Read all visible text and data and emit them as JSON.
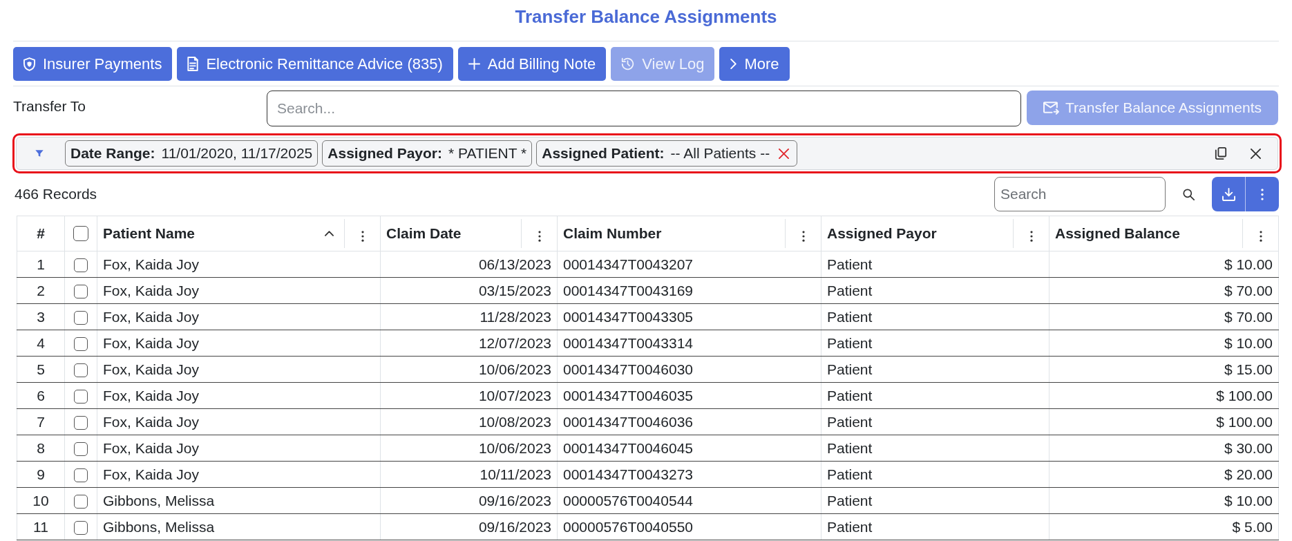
{
  "title": "Transfer Balance Assignments",
  "toolbar": [
    {
      "label": "Insurer Payments",
      "disabled": false
    },
    {
      "label": "Electronic Remittance Advice (835)",
      "disabled": false
    },
    {
      "label": "Add Billing Note",
      "disabled": false
    },
    {
      "label": "View Log",
      "disabled": true
    },
    {
      "label": "More",
      "disabled": false
    }
  ],
  "transfer": {
    "label": "Transfer To",
    "placeholder": "Search...",
    "button": {
      "label": "Transfer Balance Assignments",
      "disabled": true
    }
  },
  "filter_bar": {
    "highlighted": true,
    "filters": [
      {
        "label": "Date Range:",
        "value": "11/01/2020, 11/17/2025",
        "removable": false
      },
      {
        "label": "Assigned Payor:",
        "value": "* PATIENT *",
        "removable": false
      },
      {
        "label": "Assigned Patient:",
        "value": "-- All Patients --",
        "removable": true
      }
    ]
  },
  "record_count": "466 Records",
  "search": {
    "placeholder": "Search"
  },
  "table": {
    "columns": [
      {
        "kind": "index",
        "label": "#"
      },
      {
        "kind": "select",
        "checked": false
      },
      {
        "kind": "text",
        "label": "Patient Name",
        "sorted": true
      },
      {
        "kind": "date",
        "label": "Claim Date"
      },
      {
        "kind": "text",
        "label": "Claim Number"
      },
      {
        "kind": "text",
        "label": "Assigned Payor"
      },
      {
        "kind": "money",
        "label": "Assigned Balance"
      }
    ],
    "rows": [
      {
        "checked": false,
        "cells": [
          "1",
          "",
          "Fox, Kaida Joy",
          "06/13/2023",
          "00014347T0043207",
          "Patient",
          "$ 10.00"
        ]
      },
      {
        "checked": false,
        "cells": [
          "2",
          "",
          "Fox, Kaida Joy",
          "03/15/2023",
          "00014347T0043169",
          "Patient",
          "$ 70.00"
        ]
      },
      {
        "checked": false,
        "cells": [
          "3",
          "",
          "Fox, Kaida Joy",
          "11/28/2023",
          "00014347T0043305",
          "Patient",
          "$ 70.00"
        ]
      },
      {
        "checked": false,
        "cells": [
          "4",
          "",
          "Fox, Kaida Joy",
          "12/07/2023",
          "00014347T0043314",
          "Patient",
          "$ 10.00"
        ]
      },
      {
        "checked": false,
        "cells": [
          "5",
          "",
          "Fox, Kaida Joy",
          "10/06/2023",
          "00014347T0046030",
          "Patient",
          "$ 15.00"
        ]
      },
      {
        "checked": false,
        "cells": [
          "6",
          "",
          "Fox, Kaida Joy",
          "10/07/2023",
          "00014347T0046035",
          "Patient",
          "$ 100.00"
        ]
      },
      {
        "checked": false,
        "cells": [
          "7",
          "",
          "Fox, Kaida Joy",
          "10/08/2023",
          "00014347T0046036",
          "Patient",
          "$ 100.00"
        ]
      },
      {
        "checked": false,
        "cells": [
          "8",
          "",
          "Fox, Kaida Joy",
          "10/06/2023",
          "00014347T0046045",
          "Patient",
          "$ 30.00"
        ]
      },
      {
        "checked": false,
        "cells": [
          "9",
          "",
          "Fox, Kaida Joy",
          "10/11/2023",
          "00014347T0043273",
          "Patient",
          "$ 20.00"
        ]
      },
      {
        "checked": false,
        "cells": [
          "10",
          "",
          "Gibbons, Melissa",
          "09/16/2023",
          "00000576T0040544",
          "Patient",
          "$ 10.00"
        ]
      },
      {
        "checked": false,
        "cells": [
          "11",
          "",
          "Gibbons, Melissa",
          "09/16/2023",
          "00000576T0040550",
          "Patient",
          "$ 5.00"
        ]
      }
    ]
  }
}
